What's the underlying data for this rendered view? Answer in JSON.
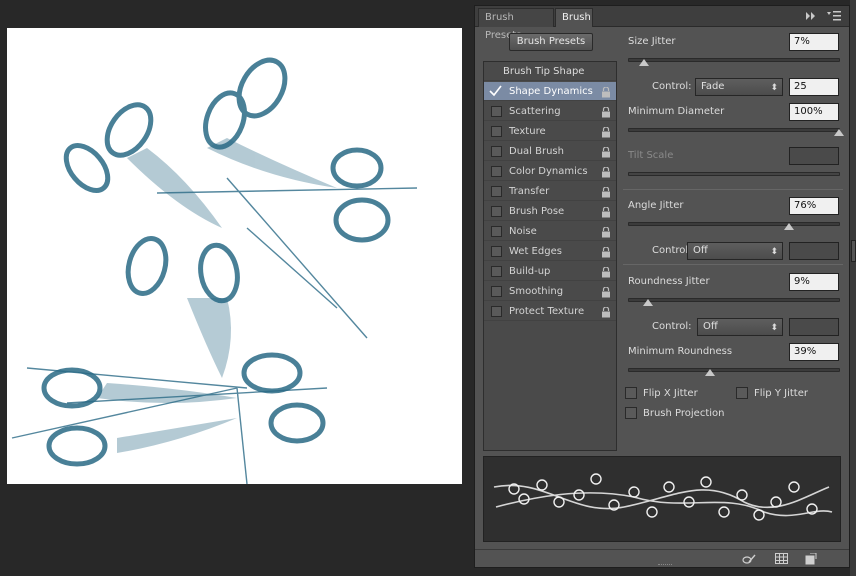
{
  "canvas": {
    "brush_color": "#2a6a86"
  },
  "panel": {
    "tabs": [
      {
        "label": "Brush Presets",
        "active": false
      },
      {
        "label": "Brush",
        "active": true
      }
    ],
    "brush_presets_button": "Brush Presets",
    "brush_tip_shape": "Brush Tip Shape",
    "options": [
      {
        "label": "Shape Dynamics",
        "checked": true,
        "selected": true
      },
      {
        "label": "Scattering",
        "checked": false
      },
      {
        "label": "Texture",
        "checked": false
      },
      {
        "label": "Dual Brush",
        "checked": false
      },
      {
        "label": "Color Dynamics",
        "checked": false
      },
      {
        "label": "Transfer",
        "checked": false
      },
      {
        "label": "Brush Pose",
        "checked": false
      },
      {
        "label": "Noise",
        "checked": false
      },
      {
        "label": "Wet Edges",
        "checked": false
      },
      {
        "label": "Build-up",
        "checked": false
      },
      {
        "label": "Smoothing",
        "checked": false
      },
      {
        "label": "Protect Texture",
        "checked": false
      }
    ],
    "settings": {
      "size_jitter": {
        "label": "Size Jitter",
        "value": "7%",
        "level": 0.07
      },
      "size_control": {
        "label": "Control:",
        "value": "Fade",
        "steps": "25"
      },
      "minimum_diameter": {
        "label": "Minimum Diameter",
        "value": "100%",
        "level": 1.0
      },
      "tilt_scale": {
        "label": "Tilt Scale"
      },
      "angle_jitter": {
        "label": "Angle Jitter",
        "value": "76%",
        "level": 0.76
      },
      "angle_control": {
        "label": "Control:",
        "value": "Off"
      },
      "roundness_jitter": {
        "label": "Roundness Jitter",
        "value": "9%",
        "level": 0.09
      },
      "roundness_control": {
        "label": "Control:",
        "value": "Off"
      },
      "minimum_roundness": {
        "label": "Minimum Roundness",
        "value": "39%",
        "level": 0.39
      },
      "flip_x": {
        "label": "Flip X Jitter",
        "checked": false
      },
      "flip_y": {
        "label": "Flip Y Jitter",
        "checked": false
      },
      "brush_projection": {
        "label": "Brush Projection",
        "checked": false
      }
    },
    "icons": {
      "tabbar": [
        "expand-arrows-icon",
        "panel-menu-icon"
      ],
      "footer": [
        "toggle-live-tip-icon",
        "grid-view-icon",
        "new-preset-icon"
      ]
    }
  }
}
